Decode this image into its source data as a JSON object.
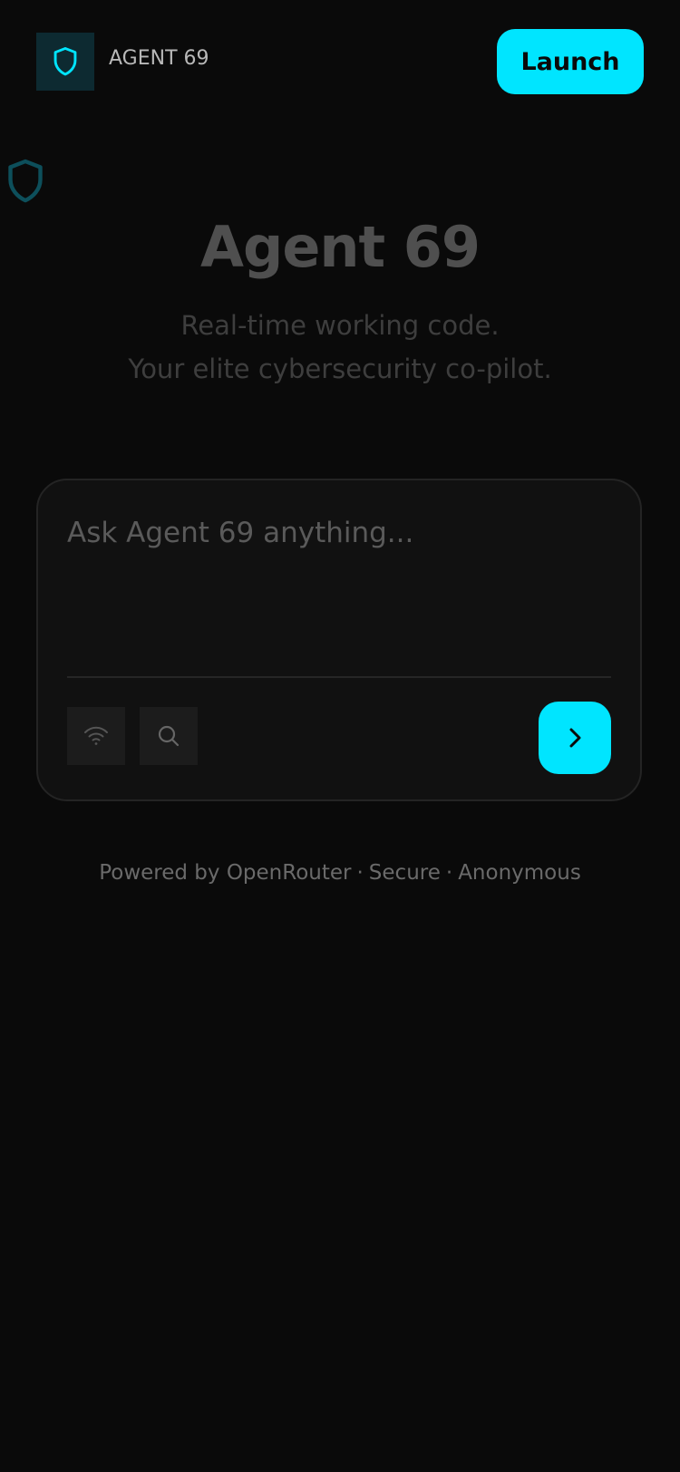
{
  "header": {
    "brand_name": "AGENT 69",
    "launch_label": "Launch",
    "logo_icon": "shield-icon"
  },
  "hero": {
    "title": "Agent 69",
    "subtitle_line1": "Real-time working code.",
    "subtitle_line2": "Your elite cybersecurity co-pilot."
  },
  "composer": {
    "placeholder": "Ask Agent 69 anything...",
    "value": "",
    "tools": [
      {
        "icon": "wifi-icon"
      },
      {
        "icon": "search-icon"
      }
    ],
    "send_icon": "chevron-right-icon"
  },
  "footer": {
    "powered_by": "Powered by OpenRouter",
    "secure": "Secure",
    "anonymous": "Anonymous",
    "separator": "·"
  },
  "colors": {
    "background": "#0a0a0a",
    "accent": "#00e5ff",
    "card": "#111111",
    "logo_bg": "#0d2a31"
  }
}
